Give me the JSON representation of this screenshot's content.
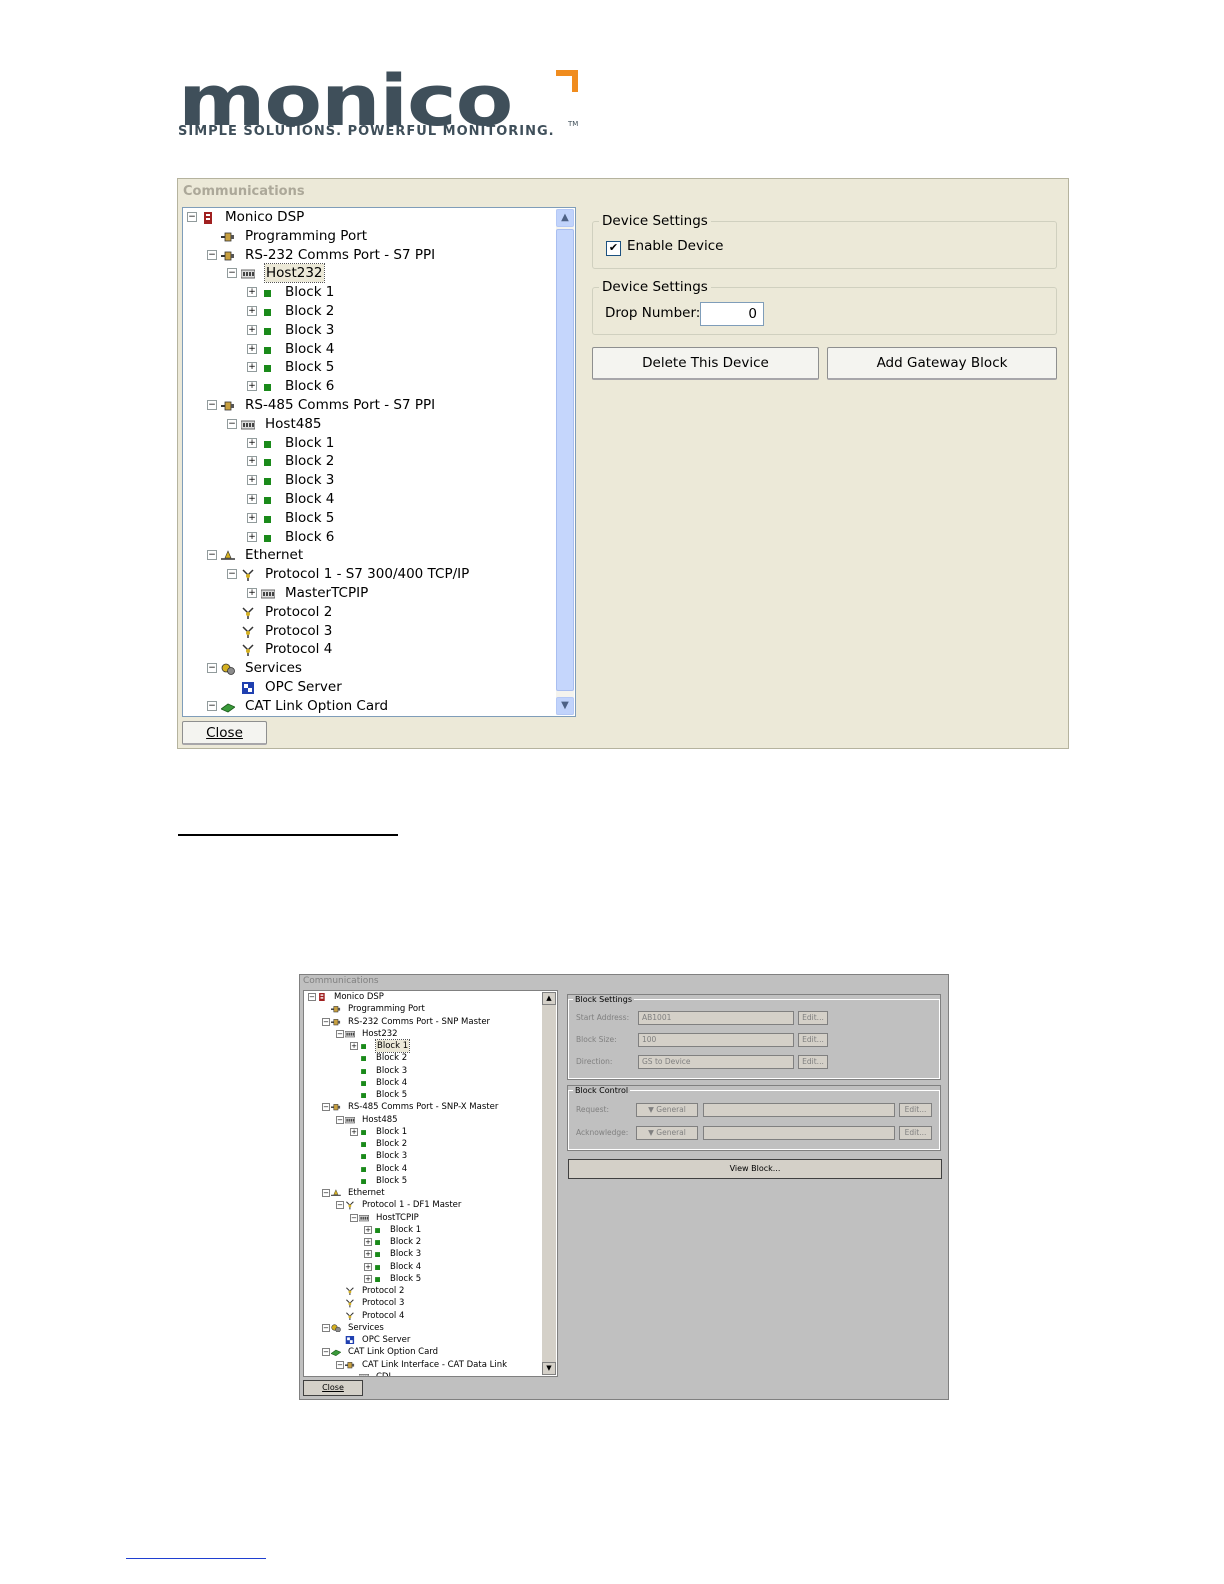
{
  "logo": {
    "word": "monico",
    "tagline": "SIMPLE SOLUTIONS. POWERFUL MONITORING.",
    "tm": "TM",
    "colors": {
      "text": "#3f4f5a",
      "accent": "#f08c1e"
    }
  },
  "dialog1": {
    "title": "Communications",
    "tree": [
      {
        "label": "Monico DSP",
        "level": 0,
        "icon": "dsp-icon",
        "exp": "-"
      },
      {
        "label": "Programming Port",
        "level": 1,
        "icon": "port-icon",
        "exp": ""
      },
      {
        "label": "RS-232 Comms Port - S7 PPI",
        "level": 1,
        "icon": "port-icon",
        "exp": "-"
      },
      {
        "label": "Host232",
        "level": 2,
        "icon": "host-icon",
        "exp": "-",
        "selected": true
      },
      {
        "label": "Block 1",
        "level": 3,
        "icon": "block-icon",
        "exp": "+"
      },
      {
        "label": "Block 2",
        "level": 3,
        "icon": "block-icon",
        "exp": "+"
      },
      {
        "label": "Block 3",
        "level": 3,
        "icon": "block-icon",
        "exp": "+"
      },
      {
        "label": "Block 4",
        "level": 3,
        "icon": "block-icon",
        "exp": "+"
      },
      {
        "label": "Block 5",
        "level": 3,
        "icon": "block-icon",
        "exp": "+"
      },
      {
        "label": "Block 6",
        "level": 3,
        "icon": "block-icon",
        "exp": "+"
      },
      {
        "label": "RS-485 Comms Port - S7 PPI",
        "level": 1,
        "icon": "port-icon",
        "exp": "-"
      },
      {
        "label": "Host485",
        "level": 2,
        "icon": "host-icon",
        "exp": "-"
      },
      {
        "label": "Block 1",
        "level": 3,
        "icon": "block-icon",
        "exp": "+"
      },
      {
        "label": "Block 2",
        "level": 3,
        "icon": "block-icon",
        "exp": "+"
      },
      {
        "label": "Block 3",
        "level": 3,
        "icon": "block-icon",
        "exp": "+"
      },
      {
        "label": "Block 4",
        "level": 3,
        "icon": "block-icon",
        "exp": "+"
      },
      {
        "label": "Block 5",
        "level": 3,
        "icon": "block-icon",
        "exp": "+"
      },
      {
        "label": "Block 6",
        "level": 3,
        "icon": "block-icon",
        "exp": "+"
      },
      {
        "label": "Ethernet",
        "level": 1,
        "icon": "ethernet-icon",
        "exp": "-"
      },
      {
        "label": "Protocol 1 - S7 300/400 TCP/IP",
        "level": 2,
        "icon": "protocol-icon",
        "exp": "-"
      },
      {
        "label": "MasterTCPIP",
        "level": 3,
        "icon": "host-icon",
        "exp": "+"
      },
      {
        "label": "Protocol 2",
        "level": 2,
        "icon": "protocol-icon",
        "exp": ""
      },
      {
        "label": "Protocol 3",
        "level": 2,
        "icon": "protocol-icon",
        "exp": ""
      },
      {
        "label": "Protocol 4",
        "level": 2,
        "icon": "protocol-icon",
        "exp": ""
      },
      {
        "label": "Services",
        "level": 1,
        "icon": "services-icon",
        "exp": "-"
      },
      {
        "label": "OPC Server",
        "level": 2,
        "icon": "opc-icon",
        "exp": ""
      },
      {
        "label": "CAT Link Option Card",
        "level": 1,
        "icon": "card-icon",
        "exp": "-"
      }
    ],
    "device_settings_1": {
      "legend": "Device Settings",
      "enable_label": "Enable Device",
      "enabled": true,
      "check_mark": "✔"
    },
    "device_settings_2": {
      "legend": "Device Settings",
      "drop_label": "Drop Number:",
      "drop_value": "0"
    },
    "delete_label": "Delete This Device",
    "add_label": "Add Gateway Block",
    "close_label": "Close"
  },
  "dialog2": {
    "title": "Communications",
    "tree": [
      {
        "label": "Monico DSP",
        "level": 0,
        "icon": "dsp-icon",
        "exp": "-"
      },
      {
        "label": "Programming Port",
        "level": 1,
        "icon": "port-icon",
        "exp": ""
      },
      {
        "label": "RS-232 Comms Port - SNP Master",
        "level": 1,
        "icon": "port-icon",
        "exp": "-"
      },
      {
        "label": "Host232",
        "level": 2,
        "icon": "host-icon",
        "exp": "-"
      },
      {
        "label": "Block 1",
        "level": 3,
        "icon": "block-icon",
        "exp": "+",
        "selected": true
      },
      {
        "label": "Block 2",
        "level": 3,
        "icon": "block-icon",
        "exp": ""
      },
      {
        "label": "Block 3",
        "level": 3,
        "icon": "block-icon",
        "exp": ""
      },
      {
        "label": "Block 4",
        "level": 3,
        "icon": "block-icon",
        "exp": ""
      },
      {
        "label": "Block 5",
        "level": 3,
        "icon": "block-icon",
        "exp": ""
      },
      {
        "label": "RS-485 Comms Port - SNP-X Master",
        "level": 1,
        "icon": "port-icon",
        "exp": "-"
      },
      {
        "label": "Host485",
        "level": 2,
        "icon": "host-icon",
        "exp": "-"
      },
      {
        "label": "Block 1",
        "level": 3,
        "icon": "block-icon",
        "exp": "+"
      },
      {
        "label": "Block 2",
        "level": 3,
        "icon": "block-icon",
        "exp": ""
      },
      {
        "label": "Block 3",
        "level": 3,
        "icon": "block-icon",
        "exp": ""
      },
      {
        "label": "Block 4",
        "level": 3,
        "icon": "block-icon",
        "exp": ""
      },
      {
        "label": "Block 5",
        "level": 3,
        "icon": "block-icon",
        "exp": ""
      },
      {
        "label": "Ethernet",
        "level": 1,
        "icon": "ethernet-icon",
        "exp": "-"
      },
      {
        "label": "Protocol 1 - DF1 Master",
        "level": 2,
        "icon": "protocol-icon",
        "exp": "-"
      },
      {
        "label": "HostTCPIP",
        "level": 3,
        "icon": "host-icon",
        "exp": "-"
      },
      {
        "label": "Block 1",
        "level": 4,
        "icon": "block-icon",
        "exp": "+"
      },
      {
        "label": "Block 2",
        "level": 4,
        "icon": "block-icon",
        "exp": "+"
      },
      {
        "label": "Block 3",
        "level": 4,
        "icon": "block-icon",
        "exp": "+"
      },
      {
        "label": "Block 4",
        "level": 4,
        "icon": "block-icon",
        "exp": "+"
      },
      {
        "label": "Block 5",
        "level": 4,
        "icon": "block-icon",
        "exp": "+"
      },
      {
        "label": "Protocol 2",
        "level": 2,
        "icon": "protocol-icon",
        "exp": ""
      },
      {
        "label": "Protocol 3",
        "level": 2,
        "icon": "protocol-icon",
        "exp": ""
      },
      {
        "label": "Protocol 4",
        "level": 2,
        "icon": "protocol-icon",
        "exp": ""
      },
      {
        "label": "Services",
        "level": 1,
        "icon": "services-icon",
        "exp": "-"
      },
      {
        "label": "OPC Server",
        "level": 2,
        "icon": "opc-icon",
        "exp": ""
      },
      {
        "label": "CAT Link Option Card",
        "level": 1,
        "icon": "card-icon",
        "exp": "-"
      },
      {
        "label": "CAT Link Interface - CAT Data Link",
        "level": 2,
        "icon": "port-icon",
        "exp": "-"
      },
      {
        "label": "CDL",
        "level": 3,
        "icon": "host-icon",
        "exp": ""
      }
    ],
    "block_settings": {
      "legend": "Block Settings",
      "rows": [
        {
          "label": "Start Address:",
          "value": "AB1001",
          "btn": "Edit..."
        },
        {
          "label": "Block Size:",
          "value": "100",
          "btn": "Edit..."
        },
        {
          "label": "Direction:",
          "value": "GS to Device",
          "btn": "Edit..."
        }
      ]
    },
    "block_control": {
      "legend": "Block Control",
      "rows": [
        {
          "label": "Request:",
          "select": "General",
          "btn": "Edit..."
        },
        {
          "label": "Acknowledge:",
          "select": "General",
          "btn": "Edit..."
        }
      ]
    },
    "view_block_label": "View Block...",
    "close_label": "Close"
  }
}
